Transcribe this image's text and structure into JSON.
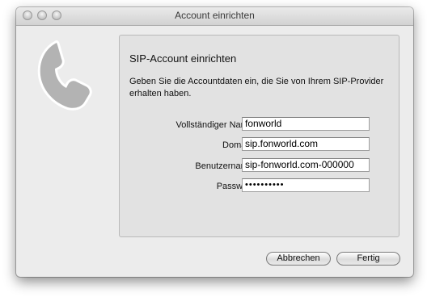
{
  "window": {
    "title": "Account einrichten"
  },
  "icons": {
    "main": "phone-handset-icon"
  },
  "panel": {
    "heading": "SIP-Account einrichten",
    "description": "Geben Sie die Accountdaten ein, die Sie von Ihrem SIP-Provider erhalten haben."
  },
  "form": {
    "full_name_label": "Vollständiger Name:",
    "full_name_value": "fonworld",
    "domain_label": "Domain:",
    "domain_value": "sip.fonworld.com",
    "username_label": "Benutzername:",
    "username_value": "sip-fonworld.com-000000",
    "password_label": "Passwort:",
    "password_value": "••••••••••"
  },
  "buttons": {
    "cancel": "Abbrechen",
    "done": "Fertig"
  }
}
